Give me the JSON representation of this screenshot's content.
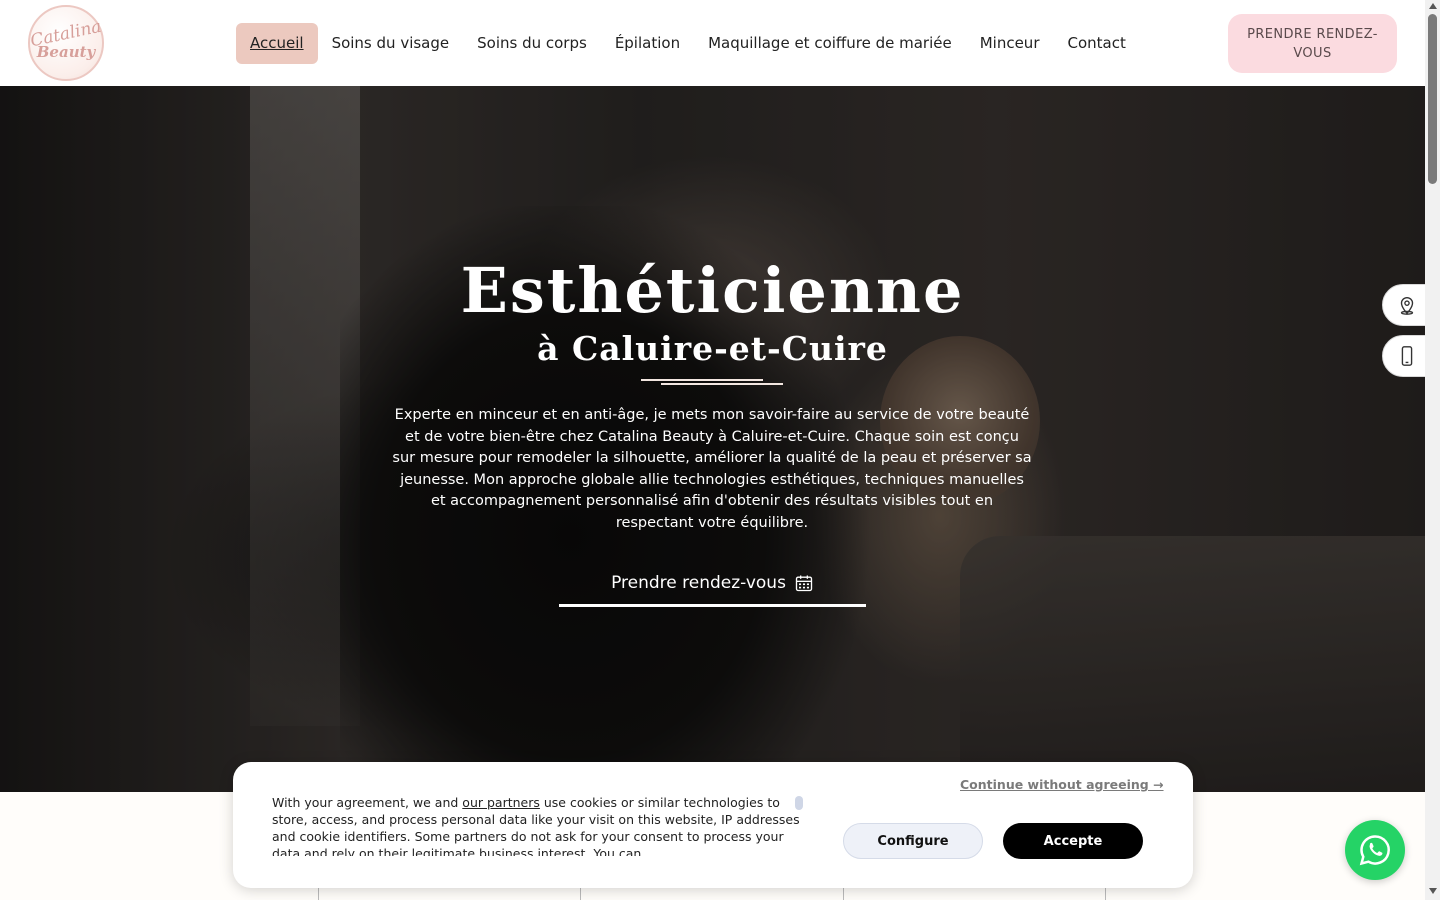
{
  "header": {
    "logo": {
      "line1": "Catalina",
      "line2": "Beauty"
    },
    "nav": [
      {
        "label": "Accueil",
        "active": true
      },
      {
        "label": "Soins du visage"
      },
      {
        "label": "Soins du corps"
      },
      {
        "label": "Épilation"
      },
      {
        "label": "Maquillage et coiffure de mariée"
      },
      {
        "label": "Minceur"
      },
      {
        "label": "Contact"
      }
    ],
    "cta": "PRENDRE RENDEZ-VOUS"
  },
  "hero": {
    "title": "Esthéticienne",
    "subtitle": "à Caluire-et-Cuire",
    "text": "Experte en minceur et en anti-âge, je mets mon savoir-faire au service de votre beauté et de votre bien-être chez Catalina Beauty à Caluire-et-Cuire. Chaque soin est conçu sur mesure pour remodeler la silhouette, améliorer la qualité de la peau et préserver sa jeunesse. Mon approche globale allie technologies esthétiques, techniques manuelles et accompagnement personnalisé afin d'obtenir des résultats visibles tout en respectant votre équilibre.",
    "button": "Prendre rendez-vous",
    "button_icon": "calendar-icon"
  },
  "side_buttons": [
    {
      "icon": "map-pin-icon"
    },
    {
      "icon": "phone-icon"
    }
  ],
  "cookie": {
    "text_before": "With your agreement, we and ",
    "partners_link": "our partners",
    "text_after": " use cookies or similar technologies to store, access, and process personal data like your visit on this website, IP addresses and cookie identifiers. Some partners do not ask for your consent to process your data and rely on their legitimate business interest. You can",
    "continue": "Continue without agreeing →",
    "configure": "Configure",
    "accept": "Accepte"
  },
  "colors": {
    "nav_active_bg": "#ecc9bf",
    "cta_bg": "#fbdbe0",
    "whatsapp": "#25d366"
  }
}
